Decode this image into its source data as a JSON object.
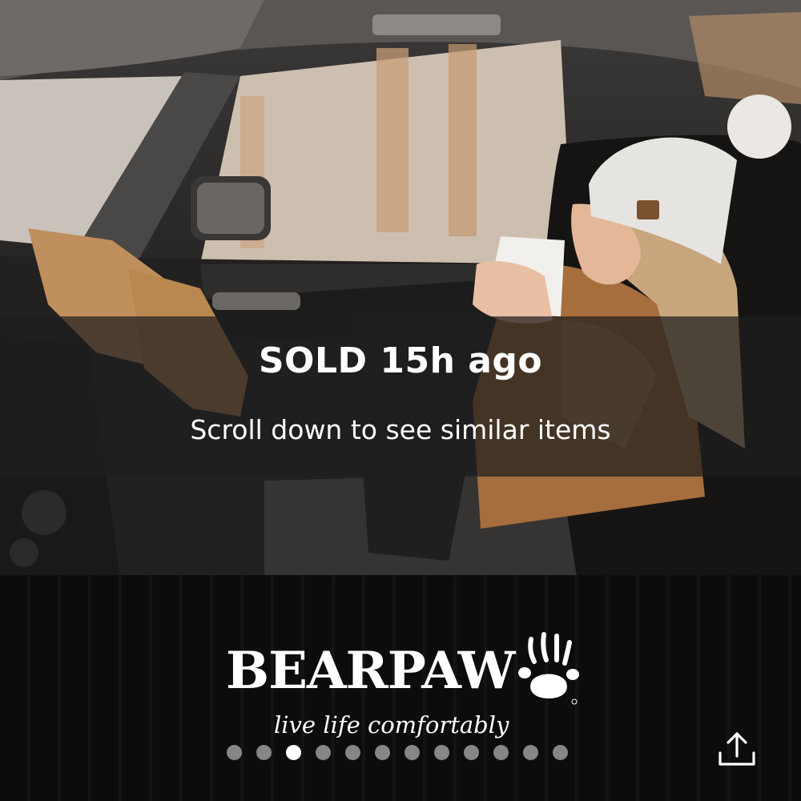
{
  "banner": {
    "title": "SOLD 15h ago",
    "subtitle": "Scroll down to see similar items"
  },
  "brand": {
    "name": "BEARPAW",
    "tagline": "live life comfortably",
    "logo_icon": "paw-print-icon"
  },
  "pager": {
    "total": 12,
    "active_index": 2
  },
  "share": {
    "icon": "share-icon"
  },
  "colors": {
    "banner_overlay": "#1e1e1e",
    "text": "#ffffff",
    "dot_inactive": "#8a8a8a",
    "dot_active": "#ffffff"
  }
}
